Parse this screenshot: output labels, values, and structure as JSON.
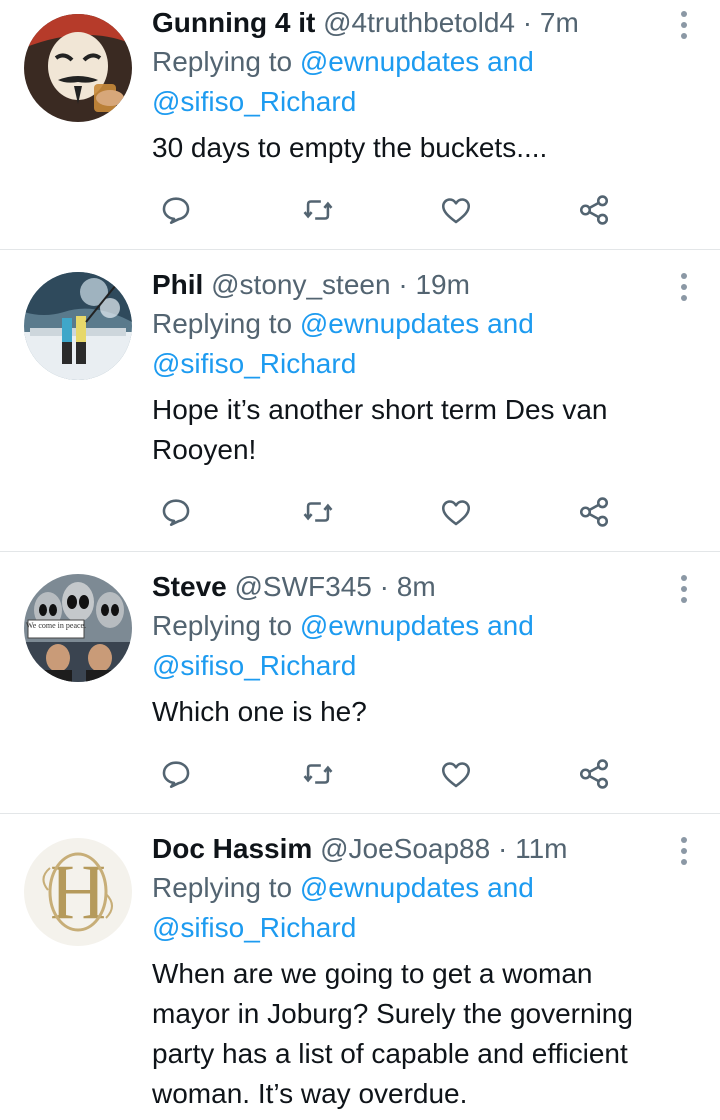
{
  "tweets": [
    {
      "display_name": "Gunning 4 it",
      "handle": "@4truthbetold4",
      "time": "7m",
      "replying_prefix": "Replying to",
      "reply_to_1": "@ewnupdates",
      "reply_and": "and",
      "reply_to_2": "@sifiso_Richard",
      "text": "30 days to empty the buckets....",
      "avatar_icon": "masked-man-avatar"
    },
    {
      "display_name": "Phil",
      "handle": "@stony_steen",
      "time": "19m",
      "replying_prefix": "Replying to",
      "reply_to_1": "@ewnupdates",
      "reply_and": "and",
      "reply_to_2": "@sifiso_Richard",
      "text": "Hope it’s another short term Des van Rooyen!",
      "avatar_icon": "fishing-boat-avatar"
    },
    {
      "display_name": "Steve",
      "handle": "@SWF345",
      "time": "8m",
      "replying_prefix": "Replying to",
      "reply_to_1": "@ewnupdates",
      "reply_and": "and",
      "reply_to_2": "@sifiso_Richard",
      "text": "Which one is he?",
      "avatar_icon": "aliens-avatar",
      "avatar_sign": "We come in peace."
    },
    {
      "display_name": "Doc Hassim",
      "handle": "@JoeSoap88",
      "time": "11m",
      "replying_prefix": "Replying to",
      "reply_to_1": "@ewnupdates",
      "reply_and": "and",
      "reply_to_2": "@sifiso_Richard",
      "text": "When are we going to get a woman mayor in Joburg? Surely the governing party has a list of capable and efficient woman. It’s way overdue.",
      "avatar_icon": "monogram-avatar"
    }
  ],
  "separator": "·",
  "colors": {
    "text": "#0f1419",
    "secondary": "#536471",
    "link": "#1d9bf0",
    "divider": "#e3e6e8"
  },
  "action_icons": [
    "reply-icon",
    "retweet-icon",
    "like-icon",
    "share-icon"
  ]
}
